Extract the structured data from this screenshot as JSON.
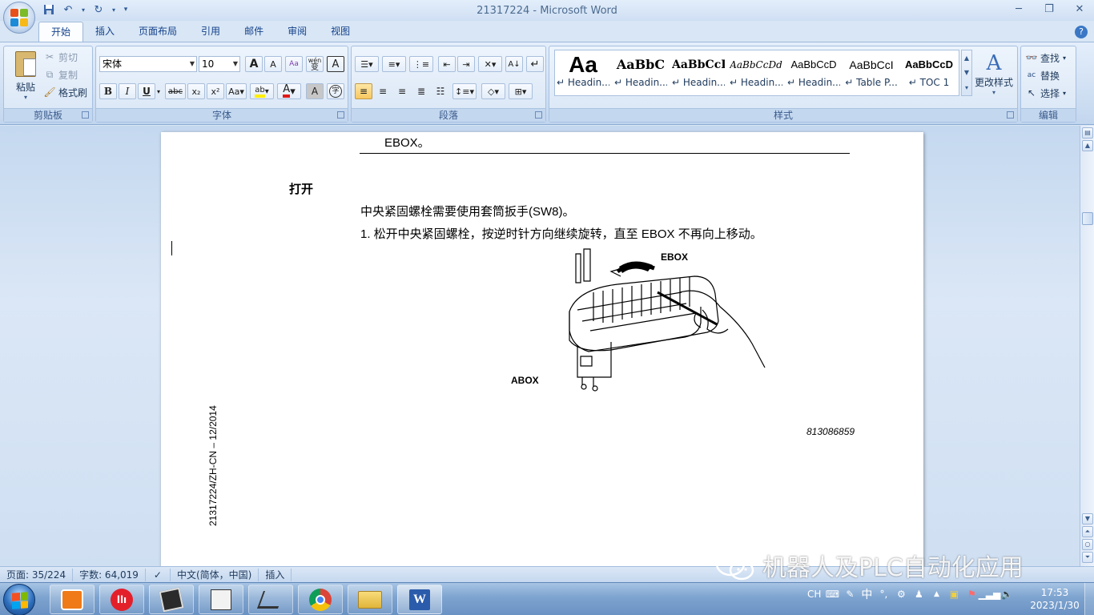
{
  "window": {
    "title": "21317224 - Microsoft Word",
    "minimize": "─",
    "maximize": "❐",
    "close": "✕"
  },
  "ribbon": {
    "tabs": [
      "开始",
      "插入",
      "页面布局",
      "引用",
      "邮件",
      "审阅",
      "视图"
    ],
    "active_tab": "开始",
    "clipboard": {
      "group_label": "剪贴板",
      "paste": "粘贴",
      "cut": "剪切",
      "copy": "复制",
      "format_painter": "格式刷"
    },
    "font": {
      "group_label": "字体",
      "font_name": "宋体",
      "font_size": "10",
      "grow": "A",
      "shrink": "A",
      "phonetic": "wén",
      "phonetic_char": "变",
      "bold": "B",
      "italic": "I",
      "underline": "U",
      "strike": "abc",
      "subscript": "x₂",
      "superscript": "x²",
      "change_case": "Aa",
      "highlight": "ab",
      "font_color": "A",
      "char_shade": "A",
      "enclose": "字"
    },
    "paragraph": {
      "group_label": "段落"
    },
    "styles": {
      "group_label": "样式",
      "items": [
        {
          "sample": "Aa",
          "name": "↵ Headin..."
        },
        {
          "sample": "AaBbC",
          "name": "↵ Headin..."
        },
        {
          "sample": "AaBbCcI",
          "name": "↵ Headin..."
        },
        {
          "sample": "AaBbCcDd",
          "name": "↵ Headin..."
        },
        {
          "sample": "AaBbCcD",
          "name": "↵ Headin..."
        },
        {
          "sample": "AaBbCcI",
          "name": "↵ Table P..."
        },
        {
          "sample": "AaBbCcD",
          "name": "↵ TOC 1"
        }
      ],
      "change_styles": "更改样式"
    },
    "editing": {
      "group_label": "编辑",
      "find": "查找",
      "replace": "替换",
      "select": "选择"
    }
  },
  "document": {
    "top_line": "EBOX。",
    "heading": "打开",
    "para1": "中央紧固螺栓需要使用套筒扳手(SW8)。",
    "step1": "1.  松开中央紧固螺栓，按逆时针方向继续旋转，直至 EBOX 不再向上移动。",
    "figure_label_ebox": "EBOX",
    "figure_label_abox": "ABOX",
    "figure_code": "813086859",
    "side_footer": "21317224/ZH-CN – 12/2014"
  },
  "statusbar": {
    "page": "页面: 35/224",
    "words": "字数: 64,019",
    "language": "中文(简体，中国)",
    "mode": "插入"
  },
  "watermark": {
    "text": "机器人及PLC自动化应用"
  },
  "taskbar": {
    "input_lang": "CH",
    "ime": "中",
    "time": "17:53",
    "date": "2023/1/30"
  },
  "colors": {
    "accent": "#15428b",
    "ribbon_bg": "#d9e6f6",
    "taskbar": "#7da3cf"
  }
}
